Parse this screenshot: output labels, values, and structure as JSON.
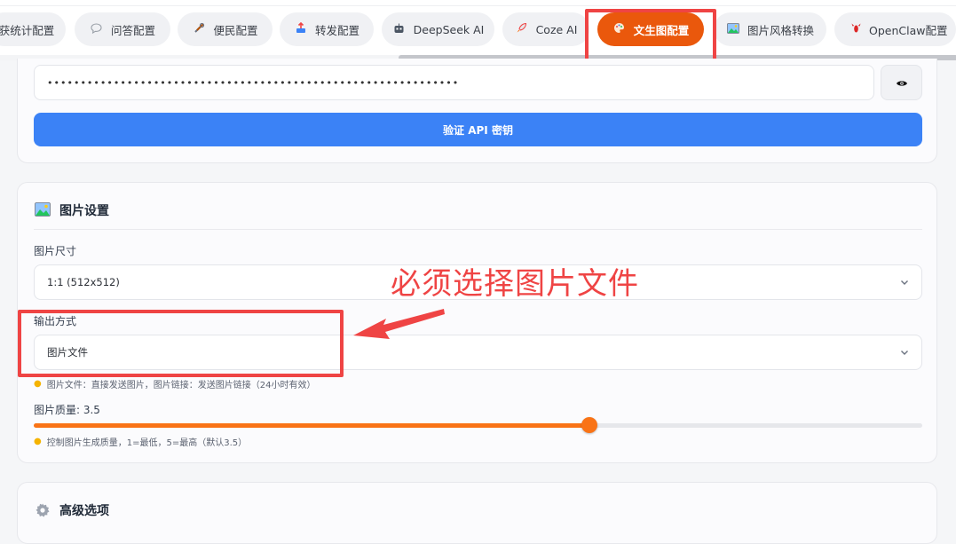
{
  "tabs": [
    {
      "label": "获统计配置",
      "icon": "chart-icon",
      "active": false
    },
    {
      "label": "问答配置",
      "icon": "speech-bubble-icon",
      "active": false
    },
    {
      "label": "便民配置",
      "icon": "tools-icon",
      "active": false
    },
    {
      "label": "转发配置",
      "icon": "forward-icon",
      "active": false
    },
    {
      "label": "DeepSeek AI",
      "icon": "robot-icon",
      "active": false
    },
    {
      "label": "Coze AI",
      "icon": "rocket-icon",
      "active": false
    },
    {
      "label": "文生图配置",
      "icon": "palette-icon",
      "active": true
    },
    {
      "label": "图片风格转换",
      "icon": "picture-icon",
      "active": false
    },
    {
      "label": "OpenClaw配置",
      "icon": "lobster-icon",
      "active": false
    }
  ],
  "api": {
    "key_value": "••••••••••••••••••••••••••••••••••••••••••••••••••••••••••••••",
    "verify_label": "验证 API 密钥"
  },
  "image_settings": {
    "title": "图片设置",
    "size_label": "图片尺寸",
    "size_value": "1:1 (512x512)",
    "output_label": "输出方式",
    "output_value": "图片文件",
    "output_hint": "图片文件：直接发送图片，图片链接：发送图片链接（24小时有效）",
    "quality_label": "图片质量: 3.5",
    "quality_value": 3.5,
    "quality_min": 1,
    "quality_max": 5,
    "quality_hint": "控制图片生成质量，1=最低，5=最高（默认3.5）"
  },
  "advanced": {
    "title": "高级选项"
  },
  "annotation": {
    "text": "必须选择图片文件",
    "color": "#ef4444"
  },
  "colors": {
    "accent": "#ea580c",
    "primary_button": "#3b82f6",
    "slider": "#f97316"
  }
}
